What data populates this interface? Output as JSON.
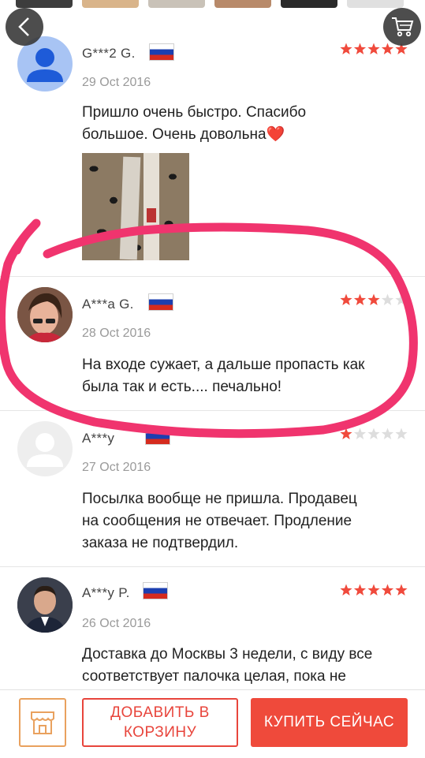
{
  "nav": {
    "back_icon": "chevron-left-icon",
    "cart_icon": "shopping-cart-icon"
  },
  "thumbnails": [
    "#3d3d3d",
    "#d9b48a",
    "#c9c2b8",
    "#b88a6a",
    "#2a2a2a",
    "#e0e0e0"
  ],
  "reviews": [
    {
      "name": "G***2 G.",
      "country_flag": "russia-flag",
      "date": "29 Oct 2016",
      "text_lines": [
        "Пришло очень быстро. Спасибо",
        "большое. Очень довольна❤️"
      ],
      "rating": 5,
      "has_photo": true
    },
    {
      "name": "A***a G.",
      "country_flag": "russia-flag",
      "date": "28 Oct 2016",
      "text_lines": [
        "На входе сужает, а дальше пропасть как",
        "была так и есть.... печально!"
      ],
      "rating": 3
    },
    {
      "name": "A***y",
      "country_flag": "russia-flag",
      "date": "27 Oct 2016",
      "text_lines": [
        "Посылка вообще не пришла. Продавец",
        "на сообщения не отвечает. Продление",
        "заказа не подтвердил."
      ],
      "rating": 1
    },
    {
      "name": "A***y P.",
      "country_flag": "russia-flag",
      "date": "26 Oct 2016",
      "text_lines": [
        "Доставка до Москвы 3 недели, с виду все",
        "соответствует палочка целая, пока не"
      ],
      "rating": 5
    }
  ],
  "bottom_bar": {
    "store_icon": "store-icon",
    "add_to_cart_line1": "ДОБАВИТЬ В",
    "add_to_cart_line2": "КОРЗИНУ",
    "buy_now": "КУПИТЬ СЕЙЧАС"
  },
  "colors": {
    "star_active": "#f04a3c",
    "star_inactive": "#dddddd",
    "accent": "#ef4a3b",
    "highlight_ring": "#f0346e"
  }
}
